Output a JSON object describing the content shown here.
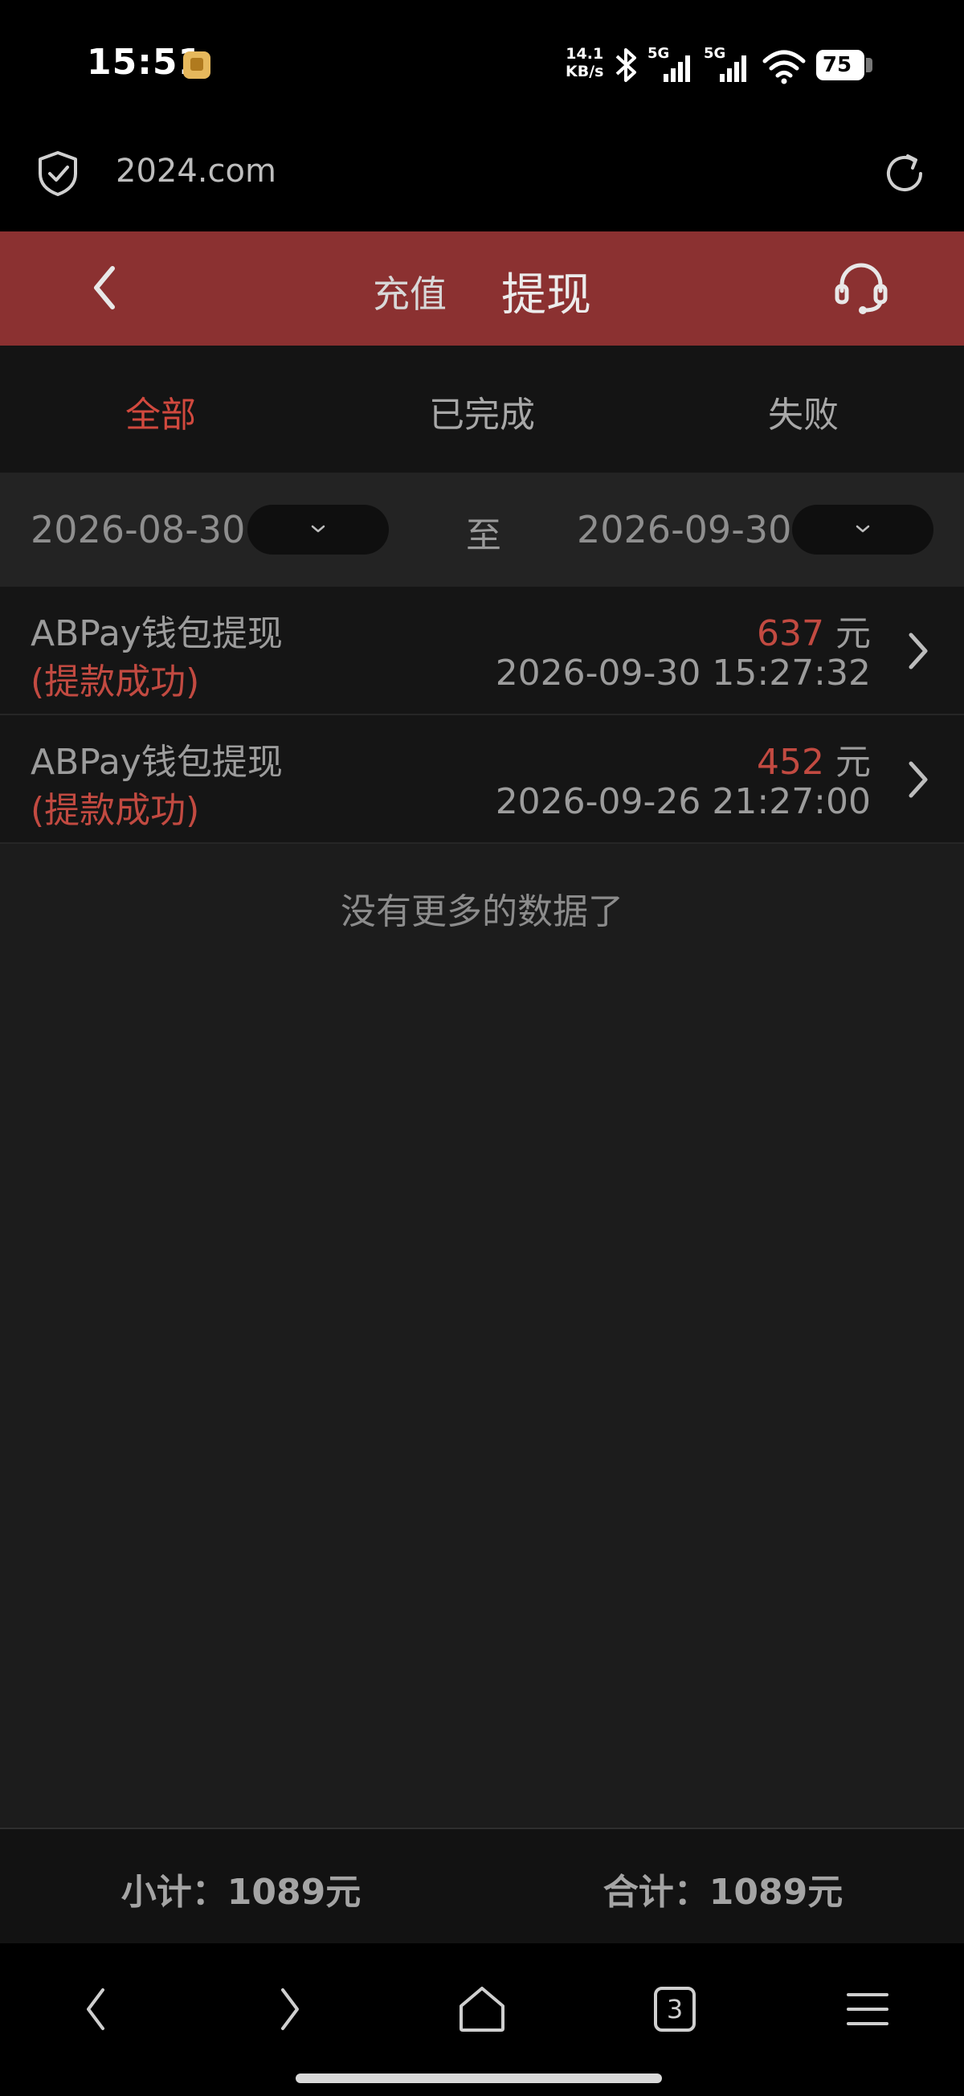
{
  "status_bar": {
    "time": "15:51",
    "net_speed_value": "14.1",
    "net_speed_unit": "KB/s",
    "signal1_label": "5G",
    "signal2_label": "5G",
    "battery": "75"
  },
  "browser": {
    "url": "2024.com"
  },
  "header": {
    "tab_recharge": "充值",
    "tab_withdraw": "提现"
  },
  "filters": {
    "all": "全部",
    "completed": "已完成",
    "failed": "失败"
  },
  "date_range": {
    "start": "2026-08-30",
    "separator": "至",
    "end": "2026-09-30"
  },
  "records": [
    {
      "title": "ABPay钱包提现",
      "status": "(提款成功)",
      "amount": "637",
      "unit": "元",
      "time": "2026-09-30 15:27:32"
    },
    {
      "title": "ABPay钱包提现",
      "status": "(提款成功)",
      "amount": "452",
      "unit": "元",
      "time": "2026-09-26 21:27:00"
    }
  ],
  "no_more_text": "没有更多的数据了",
  "summary": {
    "subtotal": "小计：1089元",
    "total": "合计：1089元"
  },
  "bottom_nav": {
    "tab_count": "3"
  },
  "colors": {
    "header_red": "#8b3131",
    "accent_red": "#c24a41",
    "background": "#1c1c1c"
  }
}
